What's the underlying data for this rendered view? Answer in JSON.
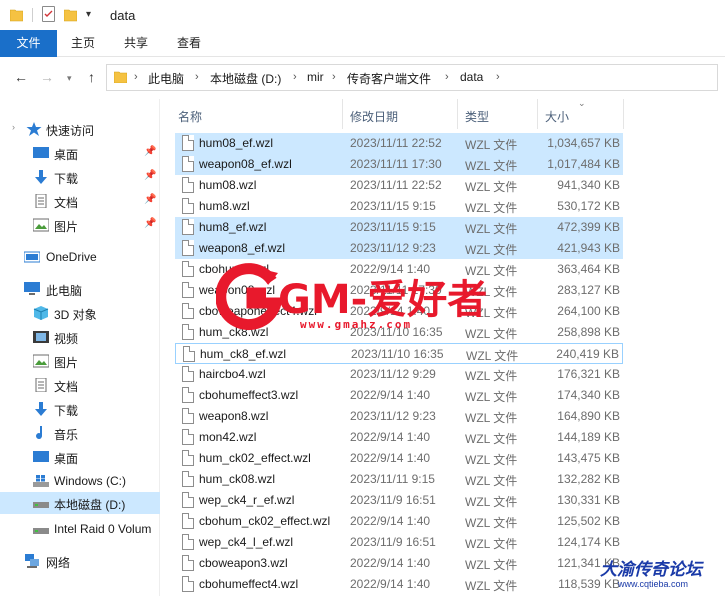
{
  "window": {
    "title": "data"
  },
  "ribbon": {
    "tabs": [
      "文件",
      "主页",
      "共享",
      "查看"
    ]
  },
  "address": {
    "crumbs": [
      "此电脑",
      "本地磁盘 (D:)",
      "mir",
      "传奇客户端文件",
      "data"
    ]
  },
  "sidebar": {
    "quick_access": "快速访问",
    "quick_items": [
      "桌面",
      "下载",
      "文档",
      "图片"
    ],
    "onedrive": "OneDrive",
    "this_pc": "此电脑",
    "pc_items": [
      "3D 对象",
      "视频",
      "图片",
      "文档",
      "下载",
      "音乐",
      "桌面",
      "Windows (C:)",
      "本地磁盘 (D:)",
      "Intel Raid 0 Volum"
    ],
    "network": "网络"
  },
  "columns": {
    "name": "名称",
    "date": "修改日期",
    "type": "类型",
    "size": "大小"
  },
  "files": [
    {
      "name": "hum08_ef.wzl",
      "date": "2023/11/11 22:52",
      "type": "WZL 文件",
      "size": "1,034,657 KB"
    },
    {
      "name": "weapon08_ef.wzl",
      "date": "2023/11/11 17:30",
      "type": "WZL 文件",
      "size": "1,017,484 KB"
    },
    {
      "name": "hum08.wzl",
      "date": "2023/11/11 22:52",
      "type": "WZL 文件",
      "size": "941,340 KB"
    },
    {
      "name": "hum8.wzl",
      "date": "2023/11/15 9:15",
      "type": "WZL 文件",
      "size": "530,172 KB"
    },
    {
      "name": "hum8_ef.wzl",
      "date": "2023/11/15 9:15",
      "type": "WZL 文件",
      "size": "472,399 KB"
    },
    {
      "name": "weapon8_ef.wzl",
      "date": "2023/11/12 9:23",
      "type": "WZL 文件",
      "size": "421,943 KB"
    },
    {
      "name": "cbohum3.wzl",
      "date": "2022/9/14 1:40",
      "type": "WZL 文件",
      "size": "363,464 KB"
    },
    {
      "name": "weapon08.wzl",
      "date": "2023/11/11 17:30",
      "type": "WZL 文件",
      "size": "283,127 KB"
    },
    {
      "name": "cboweaponeffect4.wzl",
      "date": "2022/9/14 1:40",
      "type": "WZL 文件",
      "size": "264,100 KB"
    },
    {
      "name": "hum_ck8.wzl",
      "date": "2023/11/10 16:35",
      "type": "WZL 文件",
      "size": "258,898 KB"
    },
    {
      "name": "hum_ck8_ef.wzl",
      "date": "2023/11/10 16:35",
      "type": "WZL 文件",
      "size": "240,419 KB"
    },
    {
      "name": "haircbo4.wzl",
      "date": "2023/11/12 9:29",
      "type": "WZL 文件",
      "size": "176,321 KB"
    },
    {
      "name": "cbohumeffect3.wzl",
      "date": "2022/9/14 1:40",
      "type": "WZL 文件",
      "size": "174,340 KB"
    },
    {
      "name": "weapon8.wzl",
      "date": "2023/11/12 9:23",
      "type": "WZL 文件",
      "size": "164,890 KB"
    },
    {
      "name": "mon42.wzl",
      "date": "2022/9/14 1:40",
      "type": "WZL 文件",
      "size": "144,189 KB"
    },
    {
      "name": "hum_ck02_effect.wzl",
      "date": "2022/9/14 1:40",
      "type": "WZL 文件",
      "size": "143,475 KB"
    },
    {
      "name": "hum_ck08.wzl",
      "date": "2023/11/11 9:15",
      "type": "WZL 文件",
      "size": "132,282 KB"
    },
    {
      "name": "wep_ck4_r_ef.wzl",
      "date": "2023/11/9 16:51",
      "type": "WZL 文件",
      "size": "130,331 KB"
    },
    {
      "name": "cbohum_ck02_effect.wzl",
      "date": "2022/9/14 1:40",
      "type": "WZL 文件",
      "size": "125,502 KB"
    },
    {
      "name": "wep_ck4_l_ef.wzl",
      "date": "2023/11/9 16:51",
      "type": "WZL 文件",
      "size": "124,174 KB"
    },
    {
      "name": "cboweapon3.wzl",
      "date": "2022/9/14 1:40",
      "type": "WZL 文件",
      "size": "121,341 KB"
    },
    {
      "name": "cbohumeffect4.wzl",
      "date": "2022/9/14 1:40",
      "type": "WZL 文件",
      "size": "118,539 KB"
    }
  ],
  "selected_rows": [
    0,
    1,
    4,
    5
  ],
  "focused_row": 10,
  "watermark": {
    "brand": "GM-爱好者",
    "url": "www.gmahz.com",
    "brand2": "大渝传奇论坛",
    "url2": "www.cqtieba.com"
  },
  "colors": {
    "accent": "#1a6fc9",
    "selection": "#cce8ff",
    "watermark": "#e8192c"
  }
}
